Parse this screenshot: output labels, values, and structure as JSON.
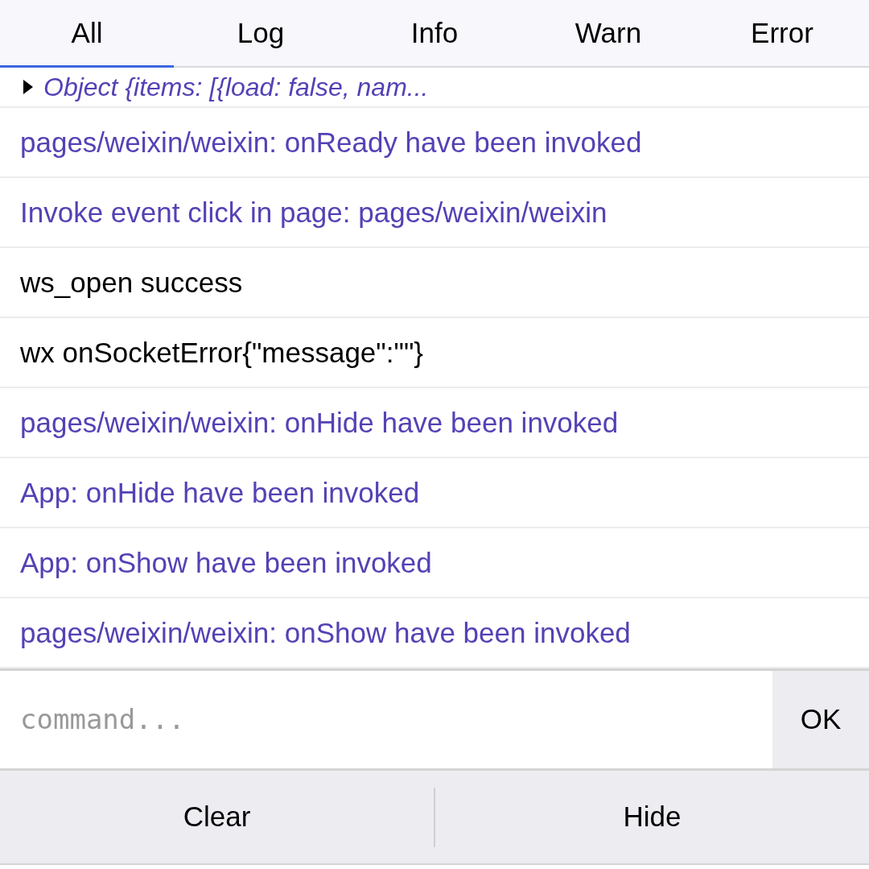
{
  "tabs": [
    {
      "label": "All",
      "selected": true
    },
    {
      "label": "Log",
      "selected": false
    },
    {
      "label": "Info",
      "selected": false
    },
    {
      "label": "Warn",
      "selected": false
    },
    {
      "label": "Error",
      "selected": false
    }
  ],
  "logs": [
    {
      "kind": "object",
      "text": "Object {items: [{load: false, nam..."
    },
    {
      "kind": "info",
      "text": "pages/weixin/weixin: onReady have been invoked"
    },
    {
      "kind": "info",
      "text": "Invoke event click in page: pages/weixin/weixin"
    },
    {
      "kind": "log",
      "text": "ws_open success"
    },
    {
      "kind": "log",
      "text": "wx onSocketError{\"message\":\"\"}"
    },
    {
      "kind": "info",
      "text": "pages/weixin/weixin: onHide have been invoked"
    },
    {
      "kind": "info",
      "text": "App: onHide have been invoked"
    },
    {
      "kind": "info",
      "text": "App: onShow have been invoked"
    },
    {
      "kind": "info",
      "text": "pages/weixin/weixin: onShow have been invoked"
    }
  ],
  "command": {
    "placeholder": "command...",
    "button": "OK"
  },
  "toolbar": [
    "Clear",
    "Hide"
  ]
}
